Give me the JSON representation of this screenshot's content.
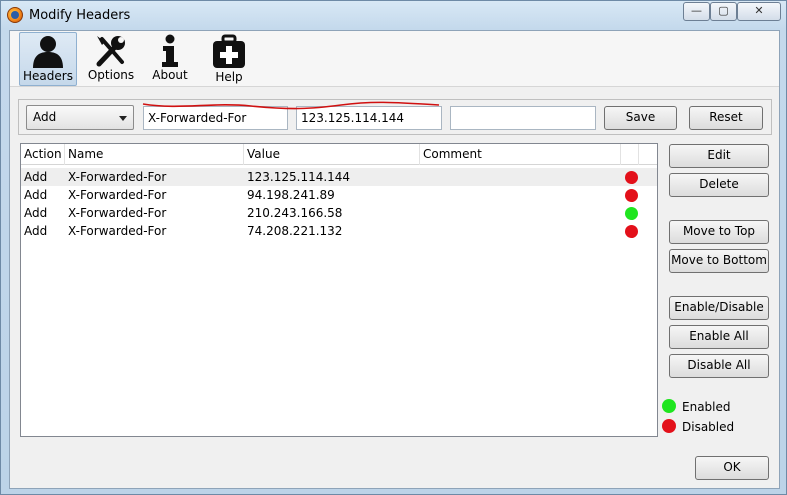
{
  "window": {
    "title": "Modify Headers"
  },
  "titlebar_buttons": {
    "minimize": "—",
    "maximize": "▢",
    "close": "✕"
  },
  "toolbar": [
    {
      "label": "Headers",
      "icon": "user-icon",
      "active": true
    },
    {
      "label": "Options",
      "icon": "tools-icon",
      "active": false
    },
    {
      "label": "About",
      "icon": "info-icon",
      "active": false
    },
    {
      "label": "Help",
      "icon": "help-kit-icon",
      "active": false
    }
  ],
  "form": {
    "action_selected": "Add",
    "name_value": "X-Forwarded-For",
    "value_value": "123.125.114.144",
    "comment_value": "",
    "save_label": "Save",
    "reset_label": "Reset"
  },
  "table": {
    "columns": [
      "Action",
      "Name",
      "Value",
      "Comment"
    ],
    "rows": [
      {
        "action": "Add",
        "name": "X-Forwarded-For",
        "value": "123.125.114.144",
        "comment": "",
        "status": "disabled",
        "selected": true
      },
      {
        "action": "Add",
        "name": "X-Forwarded-For",
        "value": "94.198.241.89",
        "comment": "",
        "status": "disabled",
        "selected": false
      },
      {
        "action": "Add",
        "name": "X-Forwarded-For",
        "value": "210.243.166.58",
        "comment": "",
        "status": "enabled",
        "selected": false
      },
      {
        "action": "Add",
        "name": "X-Forwarded-For",
        "value": "74.208.221.132",
        "comment": "",
        "status": "disabled",
        "selected": false
      }
    ]
  },
  "side_buttons": {
    "edit": "Edit",
    "delete": "Delete",
    "move_top": "Move to Top",
    "move_bottom": "Move to Bottom",
    "enable_disable": "Enable/Disable",
    "enable_all": "Enable All",
    "disable_all": "Disable All"
  },
  "legend": {
    "enabled": "Enabled",
    "disabled": "Disabled"
  },
  "ok_label": "OK",
  "colors": {
    "enabled": "#1fe51f",
    "disabled": "#e3101a",
    "annotation": "#d01010",
    "selection": "#eeeeee"
  }
}
